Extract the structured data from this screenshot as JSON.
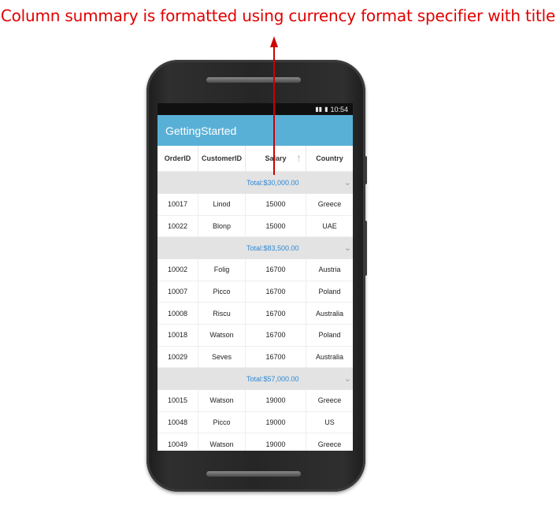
{
  "annotation": {
    "caption": "Column summary is formatted using currency format specifier with title"
  },
  "status_bar": {
    "time": "10:54",
    "signal_icon": "signal-icon",
    "battery_icon": "battery-icon"
  },
  "app_bar": {
    "title": "GettingStarted"
  },
  "grid": {
    "columns": [
      {
        "label": "OrderID"
      },
      {
        "label": "CustomerID"
      },
      {
        "label": "Salary",
        "sort_icon": "sort-ascending-icon"
      },
      {
        "label": "Country"
      }
    ],
    "groups": [
      {
        "summary": "Total:$30,000.00",
        "rows": [
          {
            "order_id": "10017",
            "customer_id": "Linod",
            "salary": "15000",
            "country": "Greece"
          },
          {
            "order_id": "10022",
            "customer_id": "Blonp",
            "salary": "15000",
            "country": "UAE"
          }
        ]
      },
      {
        "summary": "Total:$83,500.00",
        "rows": [
          {
            "order_id": "10002",
            "customer_id": "Folig",
            "salary": "16700",
            "country": "Austria"
          },
          {
            "order_id": "10007",
            "customer_id": "Picco",
            "salary": "16700",
            "country": "Poland"
          },
          {
            "order_id": "10008",
            "customer_id": "Riscu",
            "salary": "16700",
            "country": "Australia"
          },
          {
            "order_id": "10018",
            "customer_id": "Watson",
            "salary": "16700",
            "country": "Poland"
          },
          {
            "order_id": "10029",
            "customer_id": "Seves",
            "salary": "16700",
            "country": "Australia"
          }
        ]
      },
      {
        "summary": "Total:$57,000.00",
        "rows": [
          {
            "order_id": "10015",
            "customer_id": "Watson",
            "salary": "19000",
            "country": "Greece"
          },
          {
            "order_id": "10048",
            "customer_id": "Picco",
            "salary": "19000",
            "country": "US"
          },
          {
            "order_id": "10049",
            "customer_id": "Watson",
            "salary": "19000",
            "country": "Greece"
          }
        ]
      }
    ]
  },
  "colors": {
    "annotation": "#e00000",
    "app_bar": "#59b0d7",
    "summary_text": "#2e88d4",
    "group_caption_bg": "#e3e3e3"
  }
}
